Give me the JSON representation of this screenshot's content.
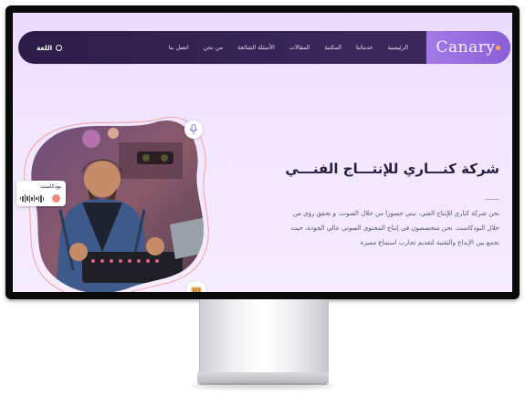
{
  "brand": {
    "name": "Canary"
  },
  "nav": {
    "items": [
      "الرئيسية",
      "خدماتنا",
      "المكتبة",
      "المقالات",
      "الأسئلة الشائعة",
      "من نحن",
      "اتصل بنا"
    ],
    "language_label": "اللغة"
  },
  "hero": {
    "title": "شركة كنـــاري للإنتـــاج الفنـــي",
    "description": "نحن شركة كناري للإنتاج الفني، نبني جسورا من خلال الصوت، و نحقق رؤى من خلال البودكاست. نحن متخصصون في إنتاج المحتوى الصوتي عالي الجودة، حيث نجمع بين الإبداع والتقنية لتقديم تجارب استماع مميزة"
  },
  "podcast_card": {
    "label": "بودكاست"
  },
  "colors": {
    "navbar": "#2b1d47",
    "brand_bg": "#9a6fe2",
    "accent": "#f08a7a",
    "background": "#f1e6ff"
  },
  "icons": [
    "globe-icon",
    "microphone-icon",
    "mixer-icon",
    "play-icon",
    "waveform-icon"
  ]
}
